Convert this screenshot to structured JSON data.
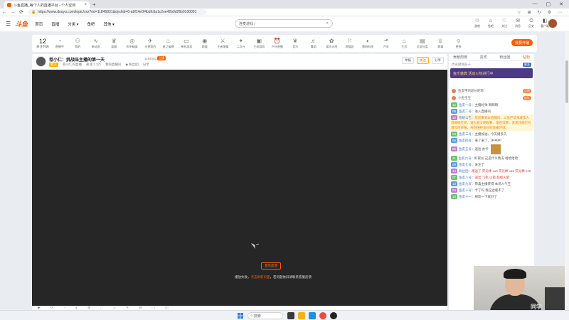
{
  "browser": {
    "tab_title": "斗鱼直播_每个人的直播平台 - 个人空间",
    "tab_close": "×",
    "new_tab": "+",
    "window_controls": [
      "—",
      "▢",
      "✕"
    ],
    "nav": [
      "←",
      "→",
      "⟳"
    ],
    "url": "https://www.douyu.com/topic/xxx?rid=11845831&dyshid=0-a9f14e0f4bdfc6a1c2ee42b0d26b0100001",
    "lock_icon": "🔒",
    "addr_icons": [
      "☆",
      "⊞",
      "↻",
      "⚙",
      "⋯"
    ]
  },
  "site": {
    "menu_icon": "☰",
    "logo": "斗鱼",
    "nav": [
      "首页",
      "直播",
      "分类 ▾",
      "鱼吧",
      "其他 ▾"
    ],
    "search_placeholder": "连麦游戏 /",
    "search_icon": "⌕",
    "header_icons": [
      {
        "glyph": "♲",
        "label": "游戏"
      },
      {
        "glyph": "⌂",
        "label": "鱼吧"
      },
      {
        "glyph": "♡",
        "label": "关注"
      },
      {
        "glyph": "✉",
        "label": "消息"
      },
      {
        "glyph": "⏱",
        "label": "历史"
      },
      {
        "glyph": "◧",
        "label": "客户端"
      }
    ]
  },
  "category_bar": {
    "follow_count": "12",
    "follow_label": "关注列表",
    "items": [
      {
        "glyph": "◔",
        "label": "直播中"
      },
      {
        "glyph": "⚇",
        "label": "我的"
      },
      {
        "glyph": "∿",
        "label": "新动态"
      },
      {
        "glyph": "♛",
        "label": "英雄"
      },
      {
        "glyph": "◎",
        "label": "和平精英"
      },
      {
        "glyph": "✈",
        "label": "无畏契约"
      },
      {
        "glyph": "♨",
        "label": "星之破晓"
      },
      {
        "glyph": "▭",
        "label": "单机游戏"
      },
      {
        "glyph": "◉",
        "label": "颜值"
      },
      {
        "glyph": "⚔",
        "label": "王者荣耀"
      },
      {
        "glyph": "✦",
        "label": "二次元"
      },
      {
        "glyph": "▣",
        "label": "主机游戏"
      },
      {
        "glyph": "⏰",
        "label": "户外直播"
      },
      {
        "glyph": "❦",
        "label": "音乐"
      },
      {
        "glyph": "♬",
        "label": "舞蹈"
      },
      {
        "glyph": "✿",
        "label": "娱乐天地"
      },
      {
        "glyph": "⚐",
        "label": "颜值区"
      },
      {
        "glyph": "◐",
        "label": "数码科技"
      },
      {
        "glyph": "⬏",
        "label": "汽车"
      },
      {
        "glyph": "⌂",
        "label": "生活"
      },
      {
        "glyph": "▤",
        "label": "全部分类"
      },
      {
        "glyph": "♕",
        "label": "赛事"
      },
      {
        "glyph": "☺",
        "label": "更多"
      }
    ],
    "start_live": "我要开播"
  },
  "room": {
    "title": "卷小仁：挑战当主播的第一天",
    "room_id": "11845831",
    "level": "主播",
    "tag": "新人",
    "sub": [
      "卷小仁的直播",
      "关注 2.3万",
      "我的直播间",
      "◆ 粉丝团",
      "分享"
    ],
    "actions": [
      "举报",
      "关注",
      "分享"
    ]
  },
  "player": {
    "feedback_label": "意见反馈",
    "message_prefix": "播放失败，",
    "message_link": "点击刷新页面",
    "message_suffix": "，若问题依旧请联系客服反馈"
  },
  "controls": [
    "▶",
    "⟳",
    "◔",
    "◐",
    "⚙",
    "⛶",
    "♫",
    "✎",
    "⊟",
    "▢",
    "◫"
  ],
  "right_panel": {
    "tabs": [
      "贡献周榜",
      "贵宾",
      "粉丝团",
      "钻粉"
    ],
    "rank_text": "周贡献榜前十",
    "rank_btn": "更多",
    "banner": "鱼乐盛典 活动火热进行中",
    "fans": [
      {
        "name": "鱼友甲的超长昵称",
        "badge": "点歌"
      },
      {
        "name": "小鱼宝宝",
        "badge": "送礼"
      }
    ],
    "chat": [
      {
        "lv": "12",
        "name": "鱼友一号",
        "text": "主播好帅 啊啊啊",
        "cls": ""
      },
      {
        "lv": "08",
        "name": "鱼友二号",
        "text": "进入直播间",
        "cls": ""
      },
      {
        "lv": "15",
        "name": "系统公告",
        "text": "欢迎来到本直播间，斗鱼严禁未成年人直播或打赏，请大家文明观看，理性消费，发现违规行为请及时举报，共同维护良好的直播环境。",
        "cls": "orange"
      },
      {
        "lv": "03",
        "name": "鱼友三号",
        "text": "主播加油，今天播多久",
        "cls": ""
      },
      {
        "lv": "06",
        "name": "鱼友四号",
        "text": "来了来了，冲冲冲！",
        "cls": ""
      },
      {
        "lv": "05",
        "name": "鱼友五号",
        "text": "送出 办卡",
        "cls": ""
      },
      {
        "lv": "11",
        "name": "鱼友六号",
        "text": "好家伙 这是什么情况 哈哈哈哈",
        "cls": ""
      },
      {
        "lv": "09",
        "name": "鱼友七号",
        "text": "关注了",
        "cls": ""
      },
      {
        "lv": "14",
        "name": "粉丝团",
        "text": "赠送了 荧光棒 x10 荧光棒 x10 荧光棒 x10",
        "cls": "red"
      },
      {
        "lv": "07",
        "name": "鱼友八号",
        "text": "送出 飞机 火箭 超级火箭",
        "cls": "red"
      },
      {
        "lv": "13",
        "name": "鱼友九号",
        "text": "恭喜主播获得 本场人气王",
        "cls": ""
      },
      {
        "lv": "04",
        "name": "鱼友十号",
        "text": "卡了吗 我这边看不了",
        "cls": ""
      },
      {
        "lv": "10",
        "name": "鱼友十一",
        "text": "刷新一下就好了",
        "cls": ""
      }
    ]
  },
  "webcam": {
    "shirt_text": "同学"
  },
  "taskbar": {
    "search": "搜索",
    "search_icon": "⌕"
  }
}
